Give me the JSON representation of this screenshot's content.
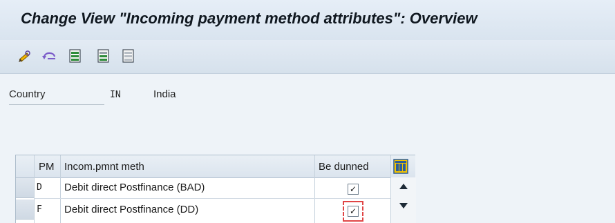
{
  "window": {
    "title": "Change View \"Incoming payment method attributes\": Overview"
  },
  "toolbar": {
    "buttons": [
      {
        "icon": "edit-pencil-icon",
        "label": ""
      },
      {
        "icon": "undo-change-icon",
        "label": ""
      },
      {
        "icon": "select-all-icon",
        "label": ""
      },
      {
        "icon": "select-block-icon",
        "label": ""
      },
      {
        "icon": "deselect-all-icon",
        "label": ""
      }
    ]
  },
  "header_fields": {
    "country_label": "Country",
    "country_code": "IN",
    "country_name": "India"
  },
  "table": {
    "columns": [
      "PM",
      "Incom.pmnt meth",
      "Be dunned"
    ],
    "rows": [
      {
        "pm": "D",
        "method": "Debit direct Postfinance (BAD)",
        "be_dunned": "✓"
      },
      {
        "pm": "F",
        "method": "Debit direct Postfinance (DD)",
        "be_dunned": "✓"
      }
    ]
  },
  "colors": {
    "title_bar": "#dde7f1",
    "accent_focus": "#e04545",
    "table_header": "#e2e9f1"
  }
}
